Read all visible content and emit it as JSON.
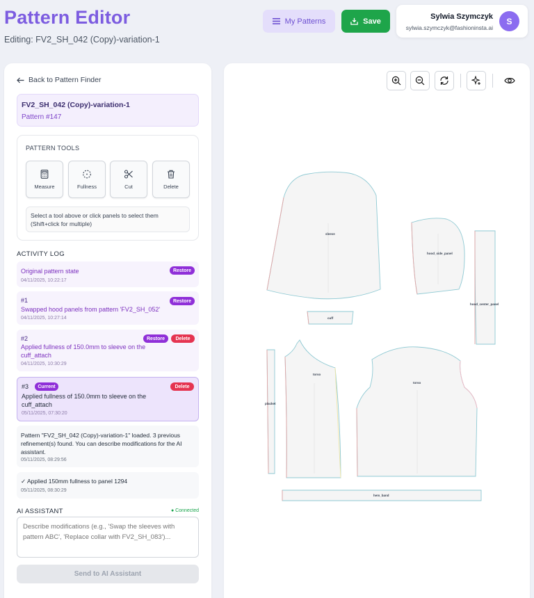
{
  "header": {
    "title": "Pattern Editor",
    "subtitle": "Editing: FV2_SH_042 (Copy)-variation-1",
    "my_patterns_label": "My Patterns",
    "save_label": "Save"
  },
  "user": {
    "name": "Sylwia Szymczyk",
    "email": "sylwia.szymczyk@fashioninsta.ai",
    "initial": "S"
  },
  "sidebar": {
    "back_label": "Back to Pattern Finder",
    "pattern_name": "FV2_SH_042 (Copy)-variation-1",
    "pattern_number": "Pattern #147",
    "tools_title": "PATTERN TOOLS",
    "tools": [
      {
        "label": "Measure",
        "icon": "calculator-icon"
      },
      {
        "label": "Fullness",
        "icon": "dashed-circle-icon"
      },
      {
        "label": "Cut",
        "icon": "scissors-icon"
      },
      {
        "label": "Delete",
        "icon": "trash-icon"
      }
    ],
    "tools_hint": "Select a tool above or click panels to select them (Shift+click for multiple)",
    "activity_title": "ACTIVITY LOG",
    "log": [
      {
        "number": "",
        "text": "Original pattern state",
        "timestamp": "04/11/2025, 10:22:17",
        "restore": "Restore"
      },
      {
        "number": "#1",
        "text": "Swapped hood panels from pattern 'FV2_SH_052'",
        "timestamp": "04/11/2025, 10:27:14",
        "restore": "Restore"
      },
      {
        "number": "#2",
        "text": "Applied fullness of 150.0mm to sleeve on the cuff_attach",
        "timestamp": "04/11/2025, 10:30:29",
        "restore": "Restore",
        "delete": "Delete"
      },
      {
        "number": "#3",
        "badge": "Current",
        "text": "Applied fullness of 150.0mm to sleeve on the cuff_attach",
        "timestamp": "05/11/2025, 07:30:20",
        "delete": "Delete"
      }
    ],
    "messages": [
      {
        "text": "Pattern \"FV2_SH_042 (Copy)-variation-1\" loaded. 3 previous refinement(s) found. You can describe modifications for the AI assistant.",
        "timestamp": "05/11/2025, 08:29:56"
      },
      {
        "text": "✓ Applied 150mm fullness to panel 1294",
        "timestamp": "05/11/2025, 08:30:29"
      }
    ],
    "ai_title": "AI ASSISTANT",
    "ai_status": "● Connected",
    "ai_placeholder": "Describe modifications (e.g., 'Swap the sleeves with pattern ABC', 'Replace collar with FV2_SH_083')...",
    "ai_send_label": "Send to AI Assistant"
  },
  "canvas": {
    "toolbar": [
      "zoom-in-icon",
      "zoom-out-icon",
      "refresh-icon",
      "sparkle-icon",
      "eye-icon"
    ],
    "pieces": {
      "sleeve": "sleeve",
      "hood_side_panel": "hood_side_panel",
      "hood_center_panel": "hood_center_panel",
      "cuff": "cuff",
      "torso_left": "torso",
      "torso_right": "torso",
      "placket": "placket",
      "hem_band": "hem_band"
    }
  }
}
